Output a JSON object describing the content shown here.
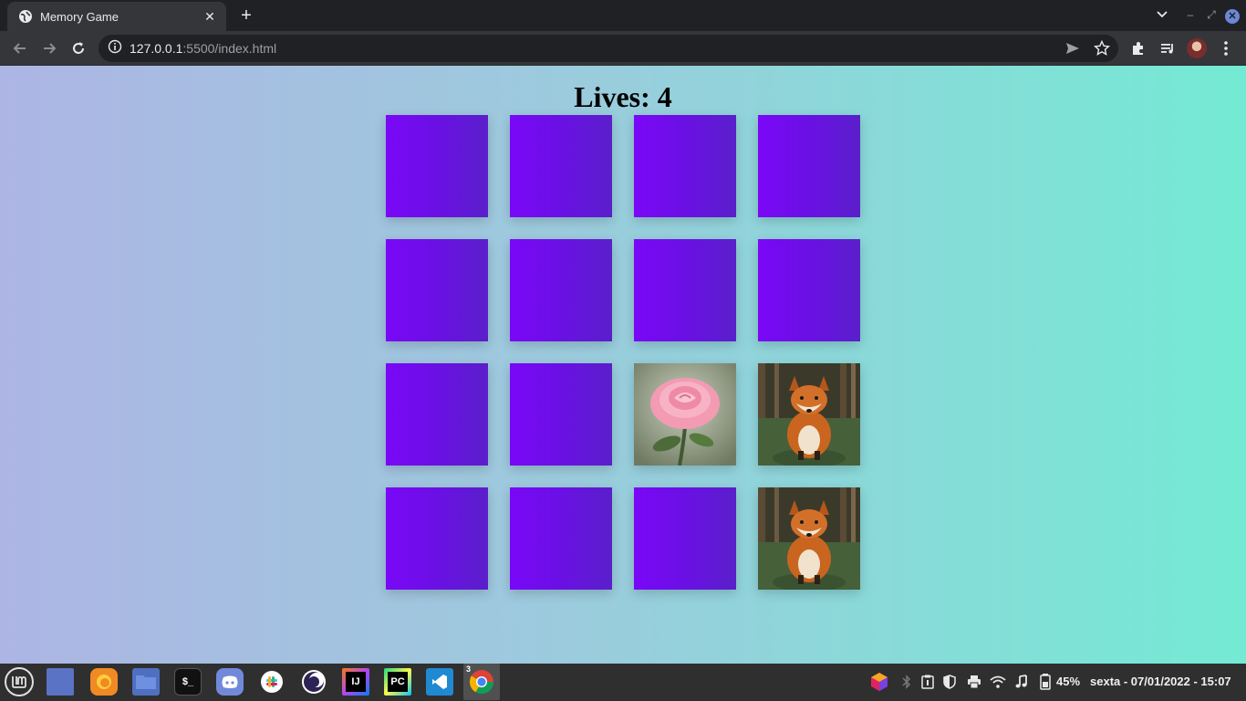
{
  "browser": {
    "tab_title": "Memory Game",
    "tab_close_glyph": "✕",
    "new_tab_glyph": "+",
    "url_host": "127.0.0.1",
    "url_rest": ":5500/index.html",
    "window_controls": {
      "minimize": "–",
      "restore": "⤢",
      "close": "✕"
    }
  },
  "game": {
    "lives_label": "Lives: 4",
    "cards": [
      {
        "state": "hidden"
      },
      {
        "state": "hidden"
      },
      {
        "state": "hidden"
      },
      {
        "state": "hidden"
      },
      {
        "state": "hidden"
      },
      {
        "state": "hidden"
      },
      {
        "state": "hidden"
      },
      {
        "state": "hidden"
      },
      {
        "state": "hidden"
      },
      {
        "state": "hidden"
      },
      {
        "state": "revealed",
        "image": "rose"
      },
      {
        "state": "revealed",
        "image": "fox"
      },
      {
        "state": "hidden"
      },
      {
        "state": "hidden"
      },
      {
        "state": "hidden"
      },
      {
        "state": "revealed",
        "image": "fox"
      }
    ],
    "card_back_color": "#7a07f7"
  },
  "taskbar": {
    "apps": [
      "mint-menu-icon",
      "show-desktop-icon",
      "firefox-icon",
      "files-icon",
      "terminal-icon",
      "discord-icon",
      "slack-icon",
      "eclipse-icon",
      "intellij-icon",
      "pycharm-icon",
      "vscode-icon",
      "chrome-icon"
    ],
    "intellij_label": "IJ",
    "pycharm_label": "PC",
    "terminal_label": "$_",
    "chrome_window_count": "3",
    "battery": "45%",
    "datetime": "sexta - 07/01/2022 - 15:07"
  }
}
